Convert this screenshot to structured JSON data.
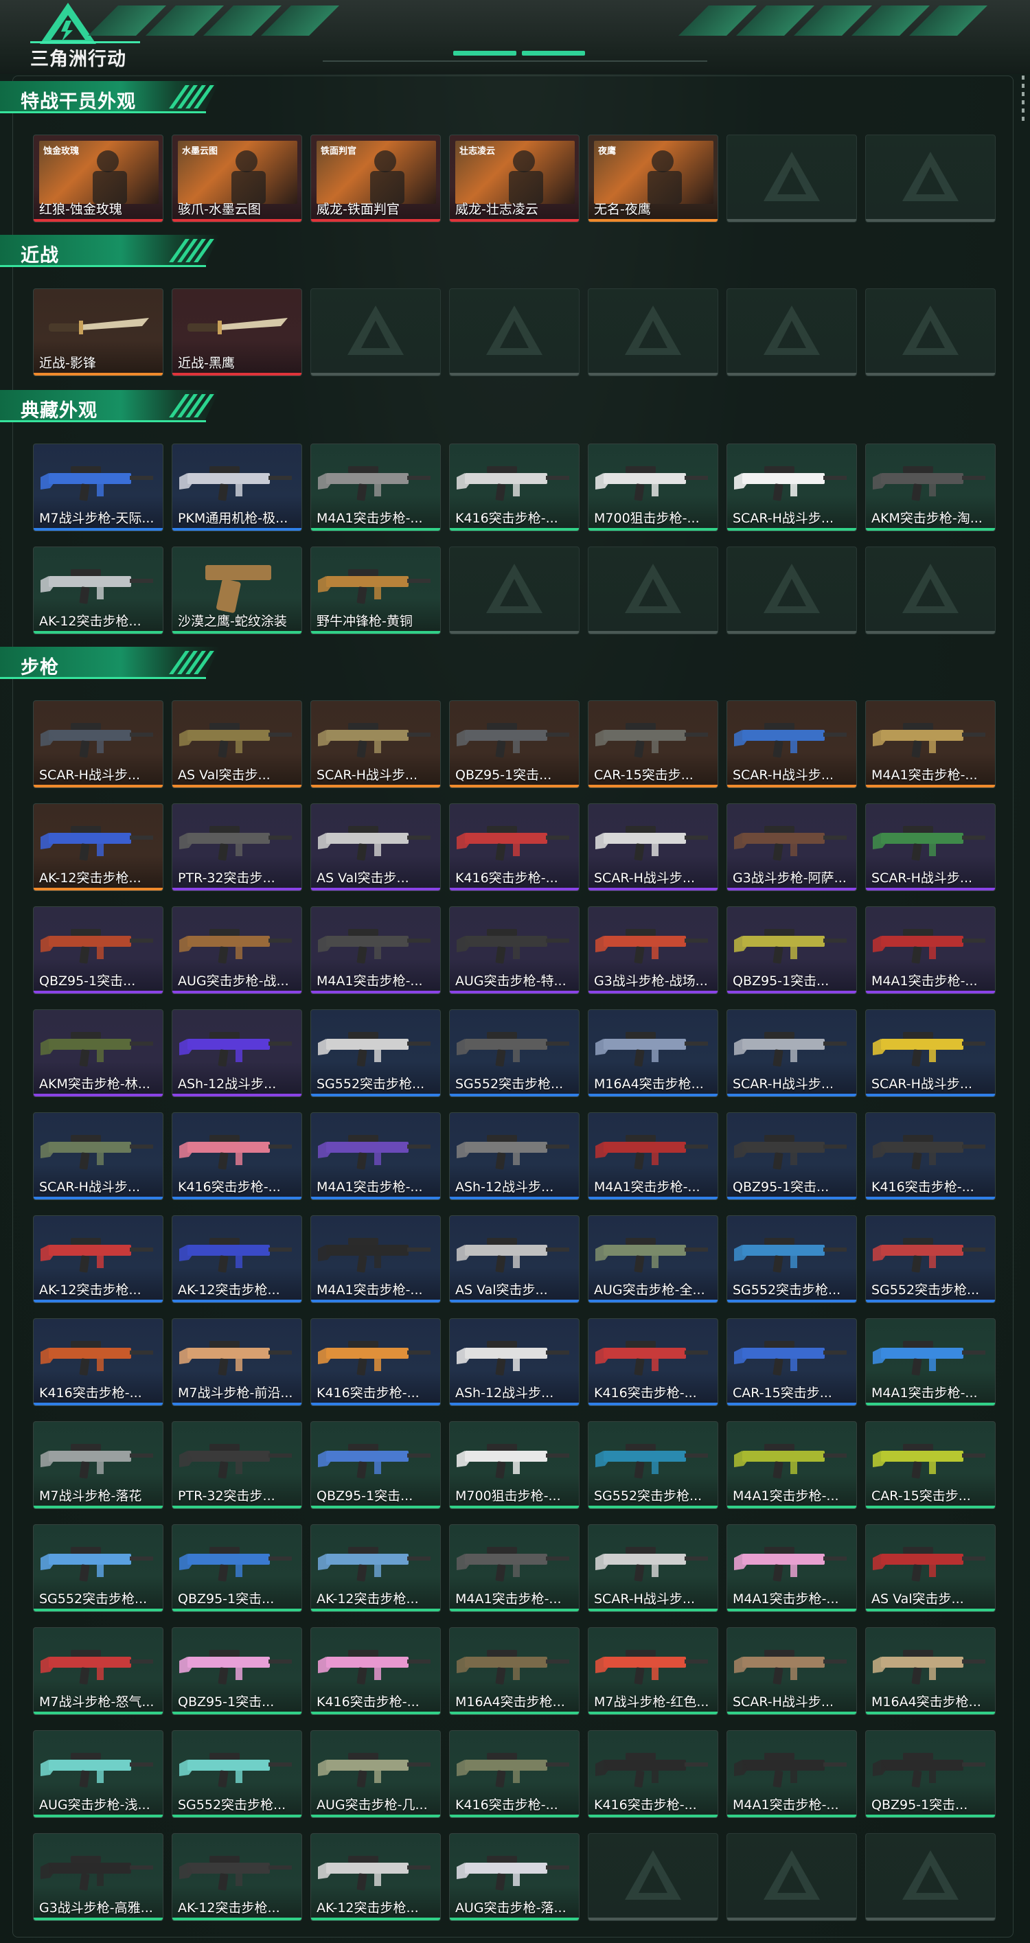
{
  "app": {
    "title": "三角洲行动"
  },
  "sections": [
    {
      "title": "特战干员外观",
      "items": [
        {
          "label": "红狼-蚀金玫瑰",
          "rarity": "red",
          "icon": "operator-skin",
          "banner": "蚀金玫瑰"
        },
        {
          "label": "骇爪-水墨云图",
          "rarity": "red",
          "icon": "operator-skin",
          "banner": "水墨云图"
        },
        {
          "label": "威龙-铁面判官",
          "rarity": "red",
          "icon": "operator-skin",
          "banner": "铁面判官"
        },
        {
          "label": "威龙-壮志凌云",
          "rarity": "red",
          "icon": "operator-skin",
          "banner": "壮志凌云"
        },
        {
          "label": "无名-夜鹰",
          "rarity": "orange",
          "icon": "operator-skin",
          "banner": "夜鹰"
        },
        {
          "label": "",
          "rarity": "empty",
          "icon": "placeholder"
        },
        {
          "label": "",
          "rarity": "empty",
          "icon": "placeholder"
        }
      ]
    },
    {
      "title": "近战",
      "items": [
        {
          "label": "近战-影锋",
          "rarity": "orange",
          "icon": "knife"
        },
        {
          "label": "近战-黑鹰",
          "rarity": "red",
          "icon": "knife"
        },
        {
          "label": "",
          "rarity": "empty",
          "icon": "placeholder"
        },
        {
          "label": "",
          "rarity": "empty",
          "icon": "placeholder"
        },
        {
          "label": "",
          "rarity": "empty",
          "icon": "placeholder"
        },
        {
          "label": "",
          "rarity": "empty",
          "icon": "placeholder"
        },
        {
          "label": "",
          "rarity": "empty",
          "icon": "placeholder"
        }
      ]
    },
    {
      "title": "典藏外观",
      "items": [
        {
          "label": "M7战斗步枪-天际...",
          "rarity": "blue",
          "icon": "rifle",
          "color": "#3a6fd8"
        },
        {
          "label": "PKM通用机枪-极...",
          "rarity": "blue",
          "icon": "rifle",
          "color": "#c9ccd6"
        },
        {
          "label": "M4A1突击步枪-...",
          "rarity": "green",
          "icon": "rifle",
          "color": "#8f8f8f"
        },
        {
          "label": "K416突击步枪-...",
          "rarity": "green",
          "icon": "rifle",
          "color": "#d7d7d7"
        },
        {
          "label": "M700狙击步枪-...",
          "rarity": "green",
          "icon": "rifle",
          "color": "#e3e3e3"
        },
        {
          "label": "SCAR-H战斗步...",
          "rarity": "green",
          "icon": "rifle",
          "color": "#f2f2f2"
        },
        {
          "label": "AKM突击步枪-淘...",
          "rarity": "green",
          "icon": "rifle",
          "color": "#555555"
        },
        {
          "label": "AK-12突击步枪...",
          "rarity": "green",
          "icon": "rifle",
          "color": "#bfc3c6"
        },
        {
          "label": "沙漠之鹰-蛇纹涂装",
          "rarity": "green",
          "icon": "pistol",
          "color": "#a27a45"
        },
        {
          "label": "野牛冲锋枪-黄铜",
          "rarity": "green",
          "icon": "rifle",
          "color": "#b8823a"
        },
        {
          "label": "",
          "rarity": "empty",
          "icon": "placeholder"
        },
        {
          "label": "",
          "rarity": "empty",
          "icon": "placeholder"
        },
        {
          "label": "",
          "rarity": "empty",
          "icon": "placeholder"
        },
        {
          "label": "",
          "rarity": "empty",
          "icon": "placeholder"
        }
      ]
    },
    {
      "title": "步枪",
      "items": [
        {
          "label": "SCAR-H战斗步...",
          "rarity": "orange",
          "icon": "rifle",
          "color": "#4d5663"
        },
        {
          "label": "AS Val突击步...",
          "rarity": "orange",
          "icon": "rifle",
          "color": "#8a7a45"
        },
        {
          "label": "SCAR-H战斗步...",
          "rarity": "orange",
          "icon": "rifle",
          "color": "#9b8a5a"
        },
        {
          "label": "QBZ95-1突击...",
          "rarity": "orange",
          "icon": "rifle",
          "color": "#5c5f63"
        },
        {
          "label": "CAR-15突击步...",
          "rarity": "orange",
          "icon": "rifle",
          "color": "#6a6a63"
        },
        {
          "label": "SCAR-H战斗步...",
          "rarity": "orange",
          "icon": "rifle",
          "color": "#3a70c8"
        },
        {
          "label": "M4A1突击步枪-...",
          "rarity": "orange",
          "icon": "rifle",
          "color": "#b89a55"
        },
        {
          "label": "AK-12突击步枪...",
          "rarity": "orange",
          "icon": "rifle",
          "color": "#3a5fd0"
        },
        {
          "label": "PTR-32突击步...",
          "rarity": "purple",
          "icon": "rifle",
          "color": "#5c5c5c"
        },
        {
          "label": "AS Val突击步...",
          "rarity": "purple",
          "icon": "rifle",
          "color": "#c9c9c9"
        },
        {
          "label": "K416突击步枪-...",
          "rarity": "purple",
          "icon": "rifle",
          "color": "#c33a3a"
        },
        {
          "label": "SCAR-H战斗步...",
          "rarity": "purple",
          "icon": "rifle",
          "color": "#d8d8d8"
        },
        {
          "label": "G3战斗步枪-阿萨...",
          "rarity": "purple",
          "icon": "rifle",
          "color": "#6e4a3a"
        },
        {
          "label": "SCAR-H战斗步...",
          "rarity": "purple",
          "icon": "rifle",
          "color": "#3f8a4a"
        },
        {
          "label": "QBZ95-1突击...",
          "rarity": "purple",
          "icon": "rifle",
          "color": "#b4482c"
        },
        {
          "label": "AUG突击步枪-战...",
          "rarity": "purple",
          "icon": "rifle",
          "color": "#9a6a3a"
        },
        {
          "label": "M4A1突击步枪-...",
          "rarity": "purple",
          "icon": "rifle",
          "color": "#4a4a4a"
        },
        {
          "label": "AUG突击步枪-特...",
          "rarity": "purple",
          "icon": "rifle",
          "color": "#3a3a3a"
        },
        {
          "label": "G3战斗步枪-战场...",
          "rarity": "purple",
          "icon": "rifle",
          "color": "#c84a32"
        },
        {
          "label": "QBZ95-1突击...",
          "rarity": "purple",
          "icon": "rifle",
          "color": "#b8b040"
        },
        {
          "label": "M4A1突击步枪-...",
          "rarity": "purple",
          "icon": "rifle",
          "color": "#b83030"
        },
        {
          "label": "AKM突击步枪-林...",
          "rarity": "purple",
          "icon": "rifle",
          "color": "#5a6a3a"
        },
        {
          "label": "ASh-12战斗步...",
          "rarity": "purple",
          "icon": "rifle",
          "color": "#5a3ad8"
        },
        {
          "label": "SG552突击步枪...",
          "rarity": "blue",
          "icon": "rifle",
          "color": "#d0d0d0"
        },
        {
          "label": "SG552突击步枪...",
          "rarity": "blue",
          "icon": "rifle",
          "color": "#5c5c5c"
        },
        {
          "label": "M16A4突击步枪...",
          "rarity": "blue",
          "icon": "rifle",
          "color": "#8a9ab8"
        },
        {
          "label": "SCAR-H战斗步...",
          "rarity": "blue",
          "icon": "rifle",
          "color": "#a8aeb8"
        },
        {
          "label": "SCAR-H战斗步...",
          "rarity": "blue",
          "icon": "rifle",
          "color": "#e0c030"
        },
        {
          "label": "SCAR-H战斗步...",
          "rarity": "blue",
          "icon": "rifle",
          "color": "#6a7a5a"
        },
        {
          "label": "K416突击步枪-...",
          "rarity": "blue",
          "icon": "rifle",
          "color": "#e07a90"
        },
        {
          "label": "M4A1突击步枪-...",
          "rarity": "blue",
          "icon": "rifle",
          "color": "#6a4ab8"
        },
        {
          "label": "ASh-12战斗步...",
          "rarity": "blue",
          "icon": "rifle",
          "color": "#7a7a7a"
        },
        {
          "label": "M4A1突击步枪-...",
          "rarity": "blue",
          "icon": "rifle",
          "color": "#b03030"
        },
        {
          "label": "QBZ95-1突击...",
          "rarity": "blue",
          "icon": "rifle",
          "color": "#3a3a3a"
        },
        {
          "label": "K416突击步枪-...",
          "rarity": "blue",
          "icon": "rifle",
          "color": "#3a3a3a"
        },
        {
          "label": "AK-12突击步枪...",
          "rarity": "blue",
          "icon": "rifle",
          "color": "#c83a3a"
        },
        {
          "label": "AK-12突击步枪...",
          "rarity": "blue",
          "icon": "rifle",
          "color": "#3a4ac8"
        },
        {
          "label": "M4A1突击步枪-...",
          "rarity": "blue",
          "icon": "rifle",
          "color": "#2a2a2a"
        },
        {
          "label": "AS Val突击步...",
          "rarity": "blue",
          "icon": "rifle",
          "color": "#c0c0c0"
        },
        {
          "label": "AUG突击步枪-全...",
          "rarity": "blue",
          "icon": "rifle",
          "color": "#7a8a6a"
        },
        {
          "label": "SG552突击步枪...",
          "rarity": "blue",
          "icon": "rifle",
          "color": "#3a8ac8"
        },
        {
          "label": "SG552突击步枪...",
          "rarity": "blue",
          "icon": "rifle",
          "color": "#c04040"
        },
        {
          "label": "K416突击步枪-...",
          "rarity": "blue",
          "icon": "rifle",
          "color": "#c85a2a"
        },
        {
          "label": "M7战斗步枪-前沿...",
          "rarity": "blue",
          "icon": "rifle",
          "color": "#d8a070"
        },
        {
          "label": "K416突击步枪-...",
          "rarity": "blue",
          "icon": "rifle",
          "color": "#e0903a"
        },
        {
          "label": "ASh-12战斗步...",
          "rarity": "blue",
          "icon": "rifle",
          "color": "#e0e0e0"
        },
        {
          "label": "K416突击步枪-...",
          "rarity": "blue",
          "icon": "rifle",
          "color": "#c83a3a"
        },
        {
          "label": "CAR-15突击步...",
          "rarity": "blue",
          "icon": "rifle",
          "color": "#3a6ad0"
        },
        {
          "label": "M4A1突击步枪-...",
          "rarity": "green",
          "icon": "rifle",
          "color": "#3a8ae0"
        },
        {
          "label": "M7战斗步枪-落花",
          "rarity": "green",
          "icon": "rifle",
          "color": "#9aa0a0"
        },
        {
          "label": "PTR-32突击步...",
          "rarity": "green",
          "icon": "rifle",
          "color": "#3a3a3a"
        },
        {
          "label": "QBZ95-1突击...",
          "rarity": "green",
          "icon": "rifle",
          "color": "#4a7ad0"
        },
        {
          "label": "M700狙击步枪-...",
          "rarity": "green",
          "icon": "rifle",
          "color": "#e8e8e8"
        },
        {
          "label": "SG552突击步枪...",
          "rarity": "green",
          "icon": "rifle",
          "color": "#2a8ab0"
        },
        {
          "label": "M4A1突击步枪-...",
          "rarity": "green",
          "icon": "rifle",
          "color": "#a8b830"
        },
        {
          "label": "CAR-15突击步...",
          "rarity": "green",
          "icon": "rifle",
          "color": "#b8c830"
        },
        {
          "label": "SG552突击步枪...",
          "rarity": "green",
          "icon": "rifle",
          "color": "#5aa0e0"
        },
        {
          "label": "QBZ95-1突击...",
          "rarity": "green",
          "icon": "rifle",
          "color": "#3a7ad0"
        },
        {
          "label": "AK-12突击步枪...",
          "rarity": "green",
          "icon": "rifle",
          "color": "#6aa0d0"
        },
        {
          "label": "M4A1突击步枪-...",
          "rarity": "green",
          "icon": "rifle",
          "color": "#5a5a5a"
        },
        {
          "label": "SCAR-H战斗步...",
          "rarity": "green",
          "icon": "rifle",
          "color": "#cfcfcf"
        },
        {
          "label": "M4A1突击步枪-...",
          "rarity": "green",
          "icon": "rifle",
          "color": "#e8a0d0"
        },
        {
          "label": "AS Val突击步...",
          "rarity": "green",
          "icon": "rifle",
          "color": "#b83030"
        },
        {
          "label": "M7战斗步枪-怒气...",
          "rarity": "green",
          "icon": "rifle",
          "color": "#c83a3a"
        },
        {
          "label": "QBZ95-1突击...",
          "rarity": "green",
          "icon": "rifle",
          "color": "#e8a0d8"
        },
        {
          "label": "K416突击步枪-...",
          "rarity": "green",
          "icon": "rifle",
          "color": "#e898d0"
        },
        {
          "label": "M16A4突击步枪...",
          "rarity": "green",
          "icon": "rifle",
          "color": "#7a6a4a"
        },
        {
          "label": "M7战斗步枪-红色...",
          "rarity": "green",
          "icon": "rifle",
          "color": "#e0503a"
        },
        {
          "label": "SCAR-H战斗步...",
          "rarity": "green",
          "icon": "rifle",
          "color": "#a08060"
        },
        {
          "label": "M16A4突击步枪...",
          "rarity": "green",
          "icon": "rifle",
          "color": "#c0a880"
        },
        {
          "label": "AUG突击步枪-浅...",
          "rarity": "green",
          "icon": "rifle",
          "color": "#70d0c8"
        },
        {
          "label": "SG552突击步枪...",
          "rarity": "green",
          "icon": "rifle",
          "color": "#70d0c8"
        },
        {
          "label": "AUG突击步枪-几...",
          "rarity": "green",
          "icon": "rifle",
          "color": "#9aa080"
        },
        {
          "label": "K416突击步枪-...",
          "rarity": "green",
          "icon": "rifle",
          "color": "#7a8060"
        },
        {
          "label": "K416突击步枪-...",
          "rarity": "green",
          "icon": "rifle",
          "color": "#2a2a2a"
        },
        {
          "label": "M4A1突击步枪-...",
          "rarity": "green",
          "icon": "rifle",
          "color": "#2a2a2a"
        },
        {
          "label": "QBZ95-1突击...",
          "rarity": "green",
          "icon": "rifle",
          "color": "#2a2a2a"
        },
        {
          "label": "G3战斗步枪-高雅...",
          "rarity": "green",
          "icon": "rifle",
          "color": "#2a2a2a"
        },
        {
          "label": "AK-12突击步枪...",
          "rarity": "green",
          "icon": "rifle",
          "color": "#3a3a3a"
        },
        {
          "label": "AK-12突击步枪...",
          "rarity": "green",
          "icon": "rifle",
          "color": "#d0d0d0"
        },
        {
          "label": "AUG突击步枪-落...",
          "rarity": "green",
          "icon": "rifle",
          "color": "#d8d8e0"
        },
        {
          "label": "",
          "rarity": "empty",
          "icon": "placeholder"
        },
        {
          "label": "",
          "rarity": "empty",
          "icon": "placeholder"
        },
        {
          "label": "",
          "rarity": "empty",
          "icon": "placeholder"
        }
      ]
    }
  ]
}
